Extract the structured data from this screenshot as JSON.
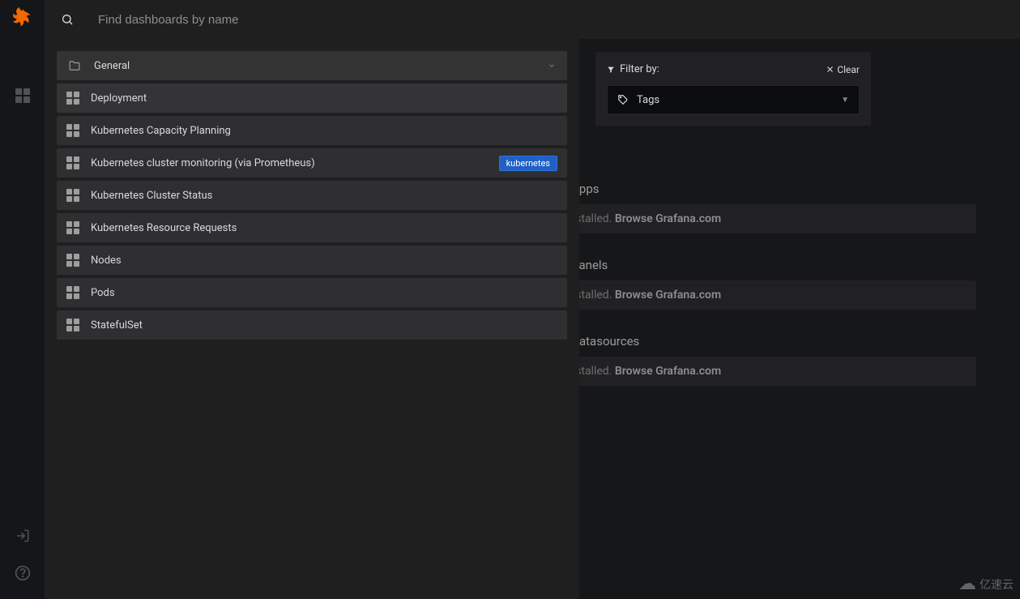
{
  "search": {
    "placeholder": "Find dashboards by name"
  },
  "folder": {
    "name": "General"
  },
  "dashboards": [
    {
      "label": "Deployment",
      "tag": null
    },
    {
      "label": "Kubernetes Capacity Planning",
      "tag": null
    },
    {
      "label": "Kubernetes cluster monitoring (via Prometheus)",
      "tag": "kubernetes"
    },
    {
      "label": "Kubernetes Cluster Status",
      "tag": null
    },
    {
      "label": "Kubernetes Resource Requests",
      "tag": null
    },
    {
      "label": "Nodes",
      "tag": null
    },
    {
      "label": "Pods",
      "tag": null
    },
    {
      "label": "StatefulSet",
      "tag": null
    }
  ],
  "filter": {
    "heading": "Filter by:",
    "clear": "Clear",
    "tags_label": "Tags"
  },
  "background": {
    "apps_h": "ed Apps",
    "apps_text": "installed.",
    "apps_link": "Browse Grafana.com",
    "panels_h": "ed Panels",
    "panels_text": "installed.",
    "panels_link": "Browse Grafana.com",
    "ds_h": "ed Datasources",
    "ds_text": "installed.",
    "ds_link": "Browse Grafana.com"
  },
  "watermark": "亿速云"
}
